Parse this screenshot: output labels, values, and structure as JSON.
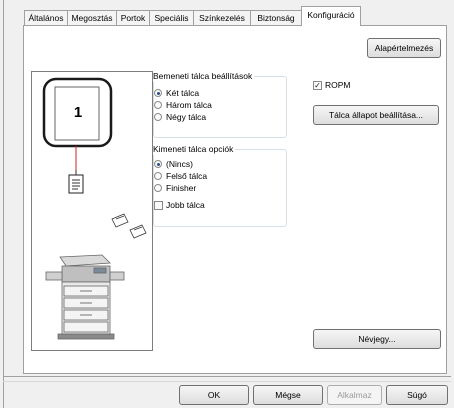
{
  "tabs": [
    {
      "label": "Általános"
    },
    {
      "label": "Megosztás"
    },
    {
      "label": "Portok"
    },
    {
      "label": "Speciális"
    },
    {
      "label": "Színkezelés"
    },
    {
      "label": "Biztonság"
    },
    {
      "label": "Konfiguráció"
    }
  ],
  "active_tab": "Konfiguráció",
  "config": {
    "defaults_button": "Alapértelmezés",
    "preview": {
      "tray_number": "1",
      "sheet_icon": "document-icon",
      "printer_image": "printer-illustration"
    },
    "input_trays": {
      "title": "Bemeneti tálca beállítások",
      "options": [
        "Két tálca",
        "Három tálca",
        "Négy tálca"
      ],
      "selected": "Két tálca"
    },
    "output_trays": {
      "title": "Kimeneti tálca opciók",
      "options": [
        "(Nincs)",
        "Felső tálca",
        "Finisher"
      ],
      "selected": "(Nincs)",
      "right_tray_label": "Jobb tálca",
      "right_tray_checked": false
    },
    "ropm_label": "ROPM",
    "ropm_checked": true,
    "tray_status_button": "Tálca állapot beállítása...",
    "namecard_button": "Névjegy..."
  },
  "footer": {
    "ok": "OK",
    "cancel": "Mégse",
    "apply": "Alkalmaz",
    "help": "Súgó"
  },
  "colors": {
    "border": "#a0a0a0",
    "panel_bg": "#ffffff",
    "window_bg": "#f0f0f0",
    "disabled_text": "#9a9a9a"
  }
}
